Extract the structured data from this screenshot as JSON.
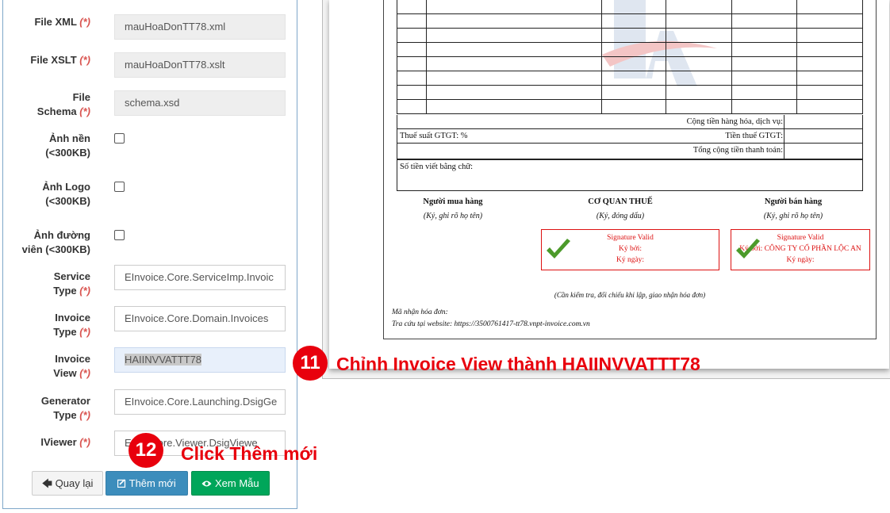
{
  "form": {
    "required_mark": "(*)",
    "file_xml": {
      "label": "File XML",
      "value": "mauHoaDonTT78.xml"
    },
    "file_xslt": {
      "label": "File XSLT",
      "value": "mauHoaDonTT78.xslt"
    },
    "file_schema": {
      "label_1": "File",
      "label_2": "Schema",
      "value": "schema.xsd"
    },
    "background_image": {
      "label_1": "Ảnh nền",
      "label_2": "(<300KB)"
    },
    "logo_image": {
      "label_1": "Ảnh Logo",
      "label_2": "(<300KB)"
    },
    "border_image": {
      "label_1": "Ảnh đường",
      "label_2": "viên (<300KB)"
    },
    "service_type": {
      "label_1": "Service",
      "label_2": "Type",
      "value": "EInvoice.Core.ServiceImp.Invoic"
    },
    "invoice_type": {
      "label_1": "Invoice",
      "label_2": "Type",
      "value": "EInvoice.Core.Domain.Invoices"
    },
    "invoice_view": {
      "label_1": "Invoice",
      "label_2": "View",
      "value": "HAIINVVATTT78"
    },
    "generator_type": {
      "label_1": "Generator",
      "label_2": "Type",
      "value": "EInvoice.Core.Launching.DsigGe"
    },
    "iviewer": {
      "label": "IViewer",
      "value_prefix": "EI",
      "value_suffix": "Core.Viewer.DsigViewe"
    }
  },
  "buttons": {
    "back": "Quay lại",
    "add": "Thêm mới",
    "view": "Xem Mẫu"
  },
  "invoice": {
    "total_goods": "Cộng tiền hàng hóa, dịch vụ:",
    "vat_rate": "Thuế suất GTGT: %",
    "vat_amount": "Tiền thuế GTGT:",
    "grand_total": "Tổng cộng tiền thanh toán:",
    "amount_words": "Số tiền viết bằng chữ:",
    "buyer_title": "Người mua hàng",
    "buyer_sub": "(Ký, ghi rõ họ tên)",
    "tax_title": "CƠ QUAN THUẾ",
    "tax_sub": "(Ký, đóng dấu)",
    "seller_title": "Người bán hàng",
    "seller_sub": "(Ký, ghi rõ họ tên)",
    "sig_valid": "Signature Valid",
    "signed_by": "Ký bởi:",
    "signed_by_company": "Ký bởi: CÔNG TY CỔ PHẦN LỘC AN",
    "signed_date": "Ký ngày:",
    "check_note": "(Cần kiểm tra, đối chiếu khi lập, giao nhận hóa đơn)",
    "receiver_code": "Mã nhận hóa đơn:",
    "lookup": "Tra cứu tại website: https://3500761417-tt78.vnpt-invoice.com.vn"
  },
  "callouts": {
    "step11_num": "11",
    "step11_text": "Chỉnh Invoice View thành HAIINVVATTT78",
    "step12_num": "12",
    "step12_text": "Click Thêm mới"
  },
  "colors": {
    "accent_red": "#e8000d",
    "btn_blue": "#3c8dbc",
    "btn_green": "#00a65a"
  },
  "icons": [
    "arrow-left-icon",
    "edit-square-icon",
    "eye-icon",
    "checkmark-icon",
    "company-logo"
  ]
}
